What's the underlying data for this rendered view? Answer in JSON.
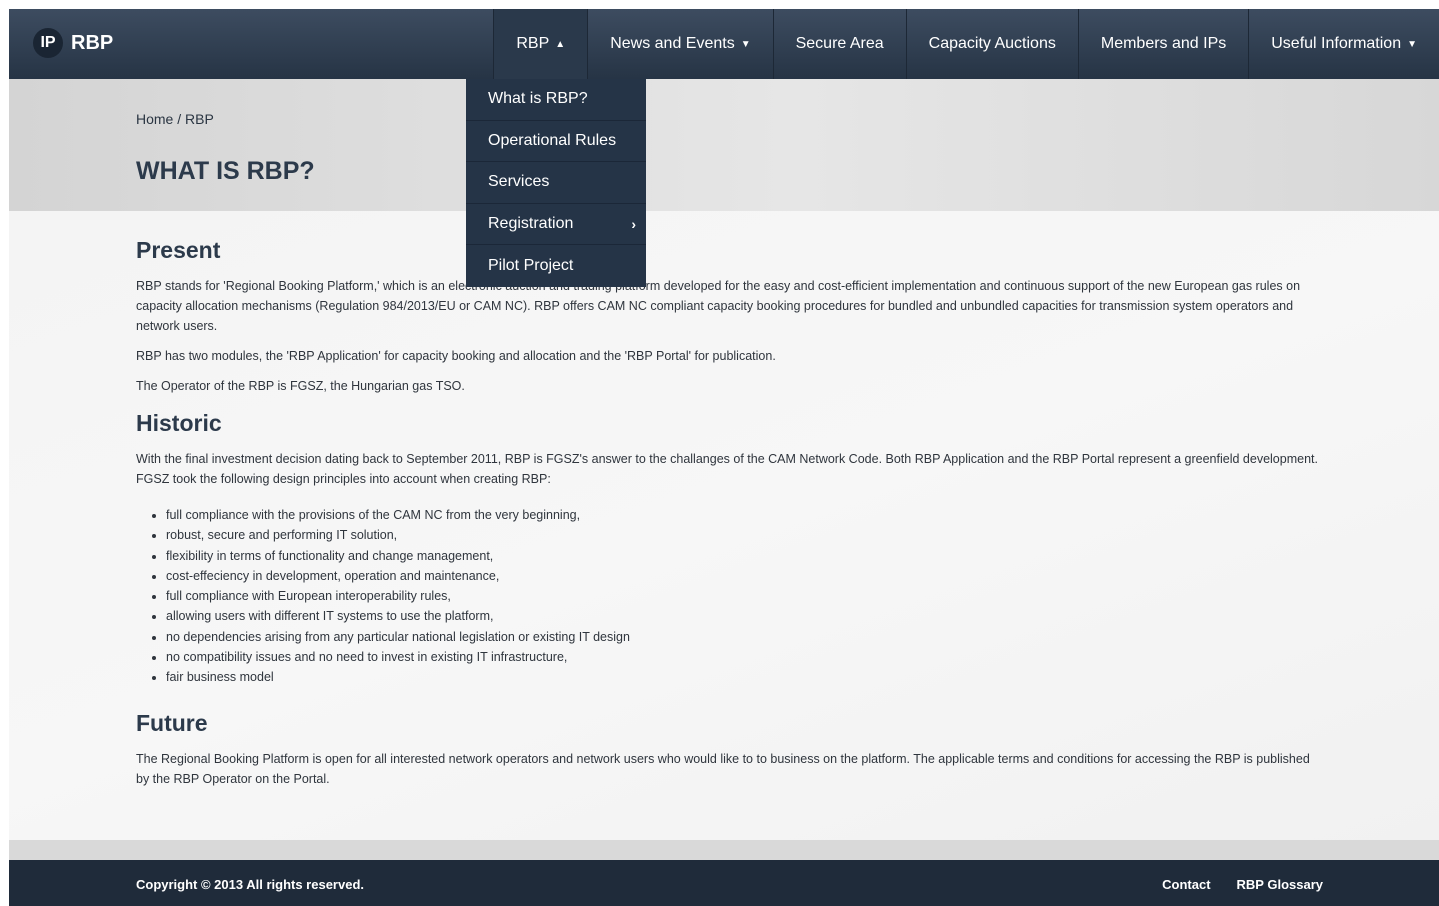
{
  "nav": {
    "logo_badge": "IP",
    "logo_text": "RBP",
    "items": [
      {
        "label": "RBP",
        "caret": "▲",
        "icon": "chevron-up-icon"
      },
      {
        "label": "News and Events",
        "caret": "▼",
        "icon": "chevron-down-icon"
      },
      {
        "label": "Secure Area"
      },
      {
        "label": "Capacity Auctions"
      },
      {
        "label": "Members and IPs"
      },
      {
        "label": "Useful Information",
        "caret": "▼",
        "icon": "chevron-down-icon"
      }
    ]
  },
  "dropdown": {
    "items": [
      {
        "label": "What is RBP?"
      },
      {
        "label": "Operational Rules"
      },
      {
        "label": "Services"
      },
      {
        "label": "Registration",
        "chev": "›",
        "icon": "chevron-right-icon"
      },
      {
        "label": "Pilot Project"
      }
    ]
  },
  "header": {
    "breadcrumb": {
      "home": "Home",
      "sep": "/",
      "current": "RBP"
    },
    "title": "WHAT IS RBP?"
  },
  "content": {
    "present": {
      "heading": "Present",
      "p1": "RBP stands for 'Regional Booking Platform,' which is an electronic auction and trading platform developed for the easy and cost-efficient implementation and continuous support of the new European gas rules on capacity allocation mechanisms (Regulation 984/2013/EU or CAM NC). RBP offers CAM NC compliant capacity booking procedures for bundled and unbundled capacities for transmission system operators and network users.",
      "p2": "RBP has two modules, the 'RBP Application' for capacity booking and allocation and the 'RBP Portal' for publication.",
      "p3": "The Operator of the RBP is FGSZ, the Hungarian gas TSO."
    },
    "historic": {
      "heading": "Historic",
      "p1": "With the final investment decision dating back to September 2011, RBP is FGSZ's answer to the challanges of the CAM Network Code.  Both RBP Application and the RBP Portal represent a greenfield development. FGSZ took the following design principles into account when creating RBP:",
      "bullets": [
        "full compliance with the provisions of the CAM NC from the very beginning,",
        "robust, secure and performing IT solution,",
        "flexibility in terms of functionality and change management,",
        "cost-effeciency in development, operation and maintenance,",
        "full compliance with European interoperability rules,",
        "allowing users with different IT systems to use the platform,",
        "no dependencies arising from any particular national legislation or existing IT design",
        "no compatibility issues and no need to invest in existing IT infrastructure,",
        "fair business model"
      ]
    },
    "future": {
      "heading": "Future",
      "p1": "The Regional Booking Platform is open for all interested network operators and network users who would like to to business on the platform. The applicable terms and conditions for accessing the RBP is published by the RBP Operator on the Portal."
    }
  },
  "footer": {
    "copyright": "Copyright © 2013 All rights reserved.",
    "links": [
      "Contact",
      "RBP Glossary"
    ]
  },
  "colors": {
    "navbar": "#2f3d50",
    "dropdown": "#253447",
    "footer": "#1f2b3a",
    "heading": "#2c3a4b"
  }
}
